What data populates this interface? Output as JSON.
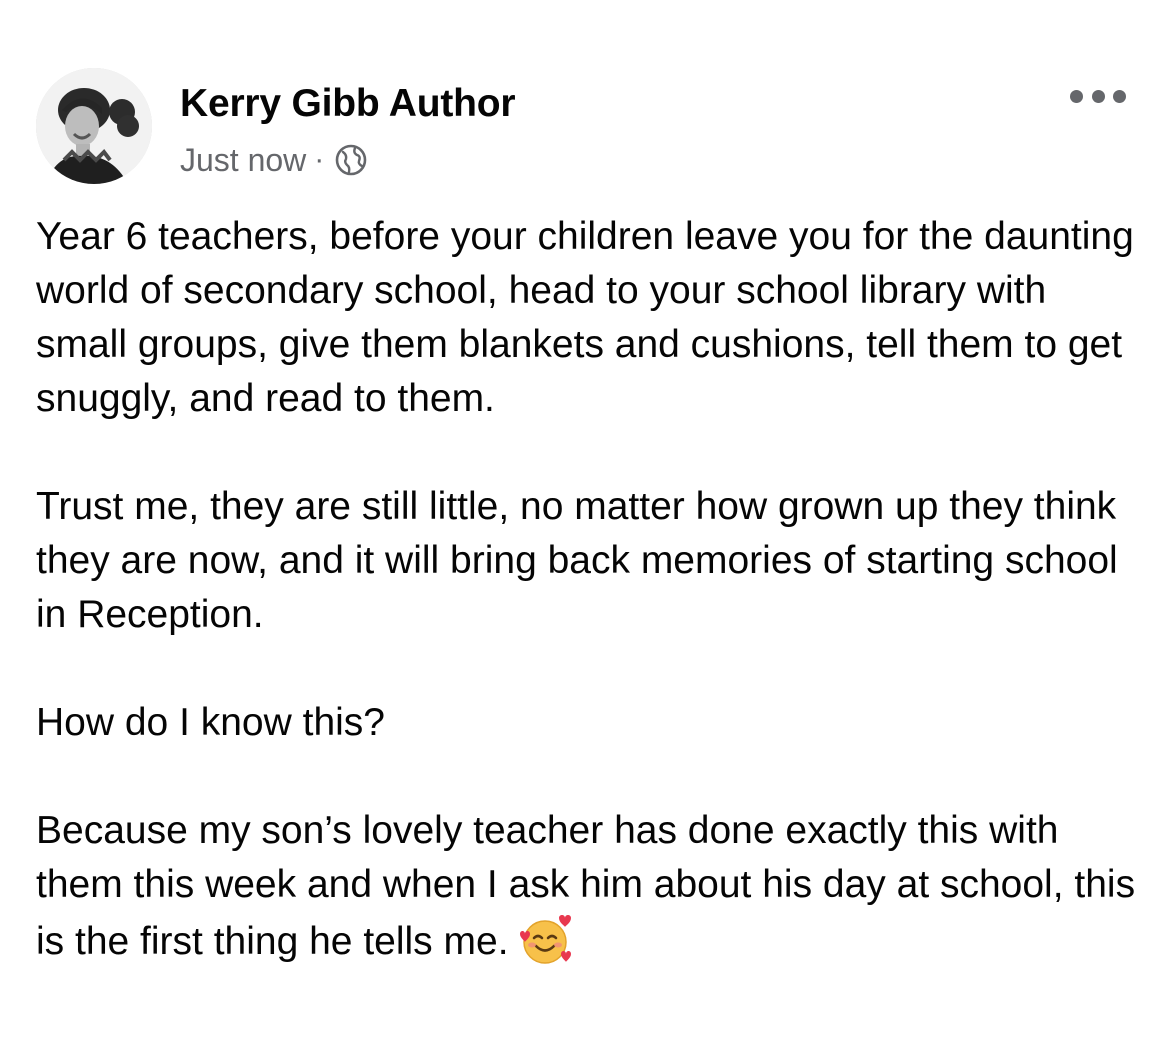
{
  "post": {
    "author": "Kerry Gibb Author",
    "timestamp": "Just now",
    "separator": "·",
    "audience_icon": "globe-icon",
    "more_icon": "more-options-icon",
    "paragraphs": [
      "Year 6 teachers, before your children leave you for the daunting world of secondary school, head to your school library with small groups, give them blankets and cushions, tell them to get snuggly, and read to them.",
      "Trust me, they are still little, no matter how grown up they think they are now, and it will bring back memories of starting school in Reception.",
      "How do I know this?",
      "Because my son’s lovely teacher has done exactly this with them this week and when I ask him about his day at school, this is the first thing he tells me."
    ],
    "trailing_emoji": "smiling-face-with-hearts-emoji"
  },
  "colors": {
    "text": "#050505",
    "secondary": "#65676b",
    "background": "#ffffff"
  }
}
